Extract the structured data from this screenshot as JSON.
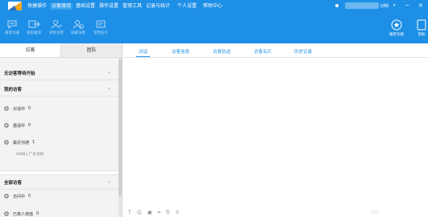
{
  "menu": {
    "items": [
      "快捷操作",
      "访客接待",
      "基础设置",
      "操作设置",
      "管理工具",
      "记录与统计",
      "个人设置",
      "帮助中心"
    ],
    "active_index": 1,
    "user_name": "旧明",
    "user_caret": "▾",
    "minimize": "─",
    "close": "✕"
  },
  "toolbar": {
    "left": [
      {
        "label": "邀请沟通",
        "icon": "chat-bubble-icon"
      },
      {
        "label": "发起邀请",
        "icon": "invite-arrow-icon"
      },
      {
        "label": "转移访客",
        "icon": "transfer-user-icon"
      },
      {
        "label": "屏蔽访客",
        "icon": "block-user-icon"
      },
      {
        "label": "常用名片",
        "icon": "card-icon"
      }
    ],
    "right": [
      {
        "label": "推荐功能",
        "icon": "recommend-icon"
      },
      {
        "label": "帮助",
        "icon": "help-icon"
      }
    ]
  },
  "left_panel": {
    "tabs": [
      "访客",
      "团队"
    ],
    "sections": [
      {
        "title": "无访客等待开始"
      },
      {
        "title": "我的访客"
      },
      {
        "title": "全部访客"
      }
    ],
    "my_visitors": [
      {
        "label": "对话中",
        "count": "0"
      },
      {
        "label": "邀请中",
        "count": "0"
      },
      {
        "label": "最近沟通",
        "count": "1"
      }
    ],
    "recent_sub": "0298 | 广东深圳",
    "all_visitors": [
      {
        "label": "访问中",
        "count": "0"
      },
      {
        "label": "已离人增值",
        "count": "0"
      }
    ]
  },
  "right_panel": {
    "tabs": [
      "对话",
      "访客信息",
      "访客轨迹",
      "访客名片",
      "历史记录"
    ],
    "active_index": 0,
    "chat_tools": [
      "T",
      "☺",
      "▣",
      "⌗",
      "⎘",
      "⚲"
    ],
    "chat_right": "○○"
  },
  "colors": {
    "accent": "#1d8fe6",
    "panel_bg": "#f3f3f3"
  }
}
